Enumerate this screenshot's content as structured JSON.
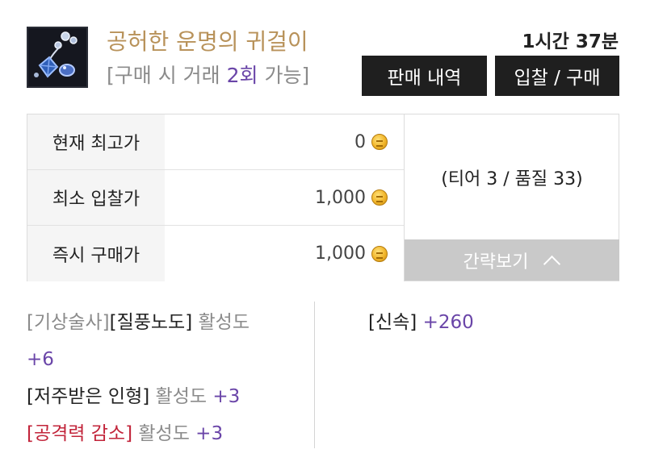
{
  "item": {
    "name": "공허한 운명의 귀걸이",
    "trade_note_prefix": "[구매 시 거래 ",
    "trade_count": "2회",
    "trade_note_suffix": " 가능]",
    "icon": "earring-icon"
  },
  "time_left": "1시간 37분",
  "buttons": {
    "history": "판매 내역",
    "bid_buy": "입찰 / 구매",
    "collapse": "간략보기"
  },
  "prices": [
    {
      "label": "현재 최고가",
      "value": "0"
    },
    {
      "label": "최소 입찰가",
      "value": "1,000"
    },
    {
      "label": "즉시 구매가",
      "value": "1,000"
    }
  ],
  "tier_quality": "(티어 3 / 품질 33)",
  "effects": {
    "e1_part1": "[기상술사]",
    "e1_part2": "[질풍노도]",
    "e1_label": " 활성도",
    "e1_value": "+6",
    "e2_name": "[저주받은 인형]",
    "e2_label": " 활성도 ",
    "e2_value": "+3",
    "e3_name": "[공격력 감소]",
    "e3_label": " 활성도 ",
    "e3_value": "+3",
    "stat_name": "[신속]",
    "stat_value": " +260"
  },
  "colors": {
    "item_name": "#b8925a",
    "accent_purple": "#6a45a8",
    "penalty_red": "#c2243a",
    "button_dark": "#1f1f1f",
    "collapse_gray": "#c9c9c9"
  }
}
